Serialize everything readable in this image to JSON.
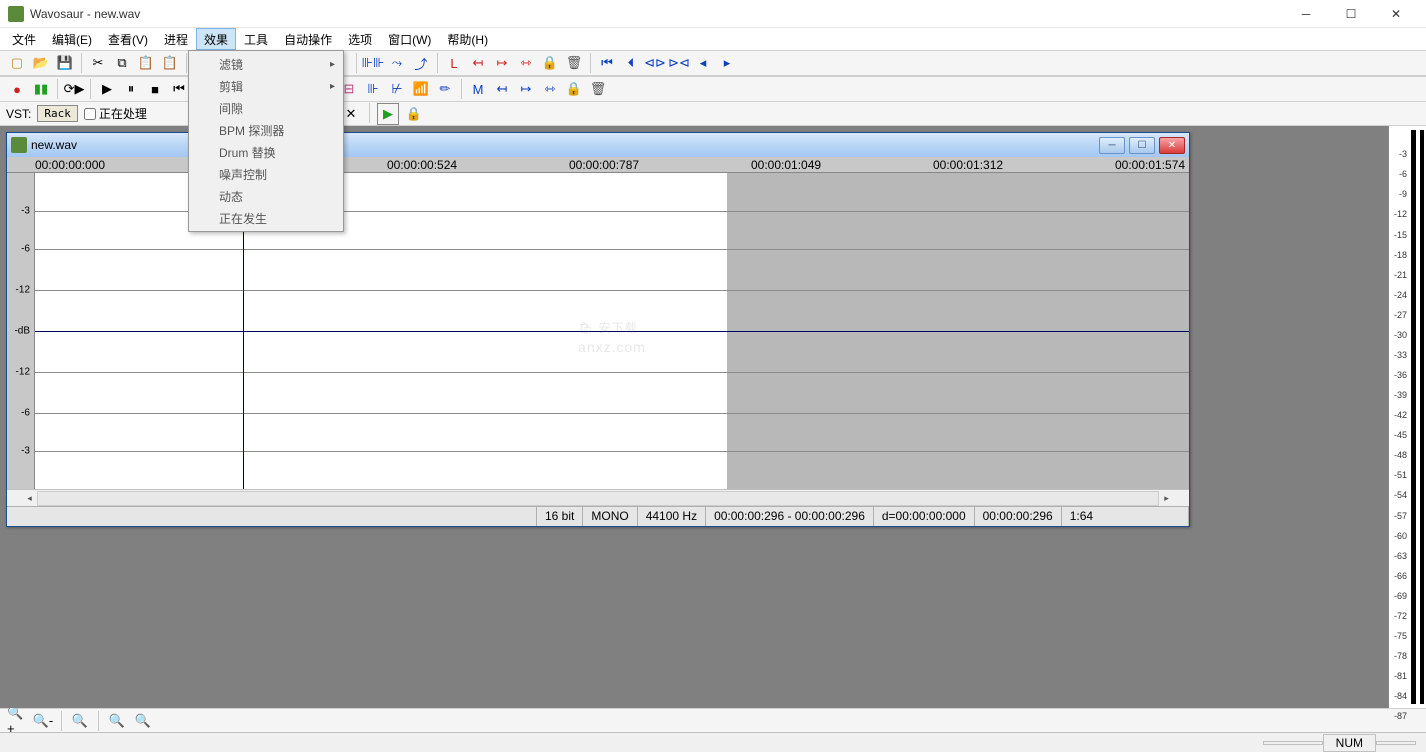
{
  "title": "Wavosaur - new.wav",
  "menubar": [
    "文件",
    "编辑(E)",
    "查看(V)",
    "进程",
    "效果",
    "工具",
    "自动操作",
    "选项",
    "窗口(W)",
    "帮助(H)"
  ],
  "active_menu_index": 4,
  "dropdown": {
    "items": [
      {
        "label": "滤镜",
        "submenu": true
      },
      {
        "label": "剪辑",
        "submenu": true
      },
      {
        "label": "间隙",
        "submenu": false
      },
      {
        "label": "BPM 探测器",
        "submenu": false
      },
      {
        "label": "Drum 替换",
        "submenu": false
      },
      {
        "label": "噪声控制",
        "submenu": false
      },
      {
        "label": "动态",
        "submenu": false
      },
      {
        "label": "正在发生",
        "submenu": false
      }
    ]
  },
  "vst": {
    "label": "VST:",
    "rack": "Rack",
    "processing": "正在处理"
  },
  "doc": {
    "title": "new.wav",
    "time_ruler": [
      "00:00:00:000",
      "00:00:00:524",
      "00:00:00:787",
      "00:00:01:049",
      "00:00:01:312",
      "00:00:01:574"
    ],
    "db_scale": [
      "-3",
      "-6",
      "-12",
      "-dB",
      "-12",
      "-6",
      "-3"
    ],
    "status": {
      "bit": "16 bit",
      "channels": "MONO",
      "rate": "44100 Hz",
      "selection": "00:00:00:296 - 00:00:00:296",
      "duration": "d=00:00:00:000",
      "position": "00:00:00:296",
      "zoom": "1:64"
    }
  },
  "meter_ticks": [
    "-3",
    "-6",
    "-9",
    "-12",
    "-15",
    "-18",
    "-21",
    "-24",
    "-27",
    "-30",
    "-33",
    "-36",
    "-39",
    "-42",
    "-45",
    "-48",
    "-51",
    "-54",
    "-57",
    "-60",
    "-63",
    "-66",
    "-69",
    "-72",
    "-75",
    "-78",
    "-81",
    "-84",
    "-87"
  ],
  "app_status": {
    "indicator": "NUM"
  },
  "watermark": {
    "main": "安下载",
    "sub": "anxz.com"
  }
}
